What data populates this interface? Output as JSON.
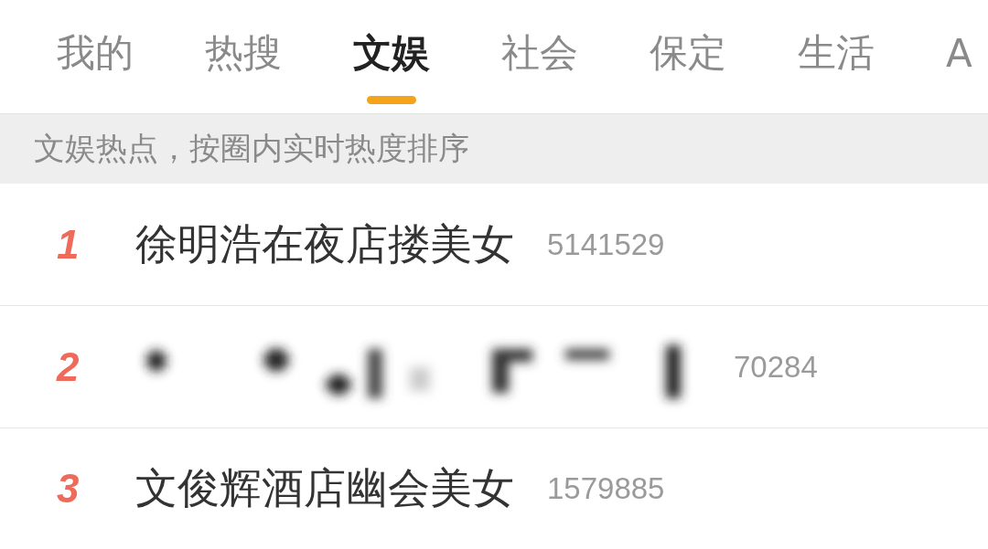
{
  "tabs": [
    {
      "label": "我的",
      "selected": false
    },
    {
      "label": "热搜",
      "selected": false
    },
    {
      "label": "文娱",
      "selected": true
    },
    {
      "label": "社会",
      "selected": false
    },
    {
      "label": "保定",
      "selected": false
    },
    {
      "label": "生活",
      "selected": false
    },
    {
      "label": "A",
      "selected": false
    }
  ],
  "notice": {
    "text": "文娱热点，按圈内实时热度排序"
  },
  "hot_list": [
    {
      "rank": "1",
      "redacted": false,
      "title": "徐明浩在夜店搂美女",
      "count": "5141529"
    },
    {
      "rank": "2",
      "redacted": true,
      "count": "70284"
    },
    {
      "rank": "3",
      "redacted": false,
      "title": "文俊辉酒店幽会美女",
      "count": "1579885"
    }
  ]
}
